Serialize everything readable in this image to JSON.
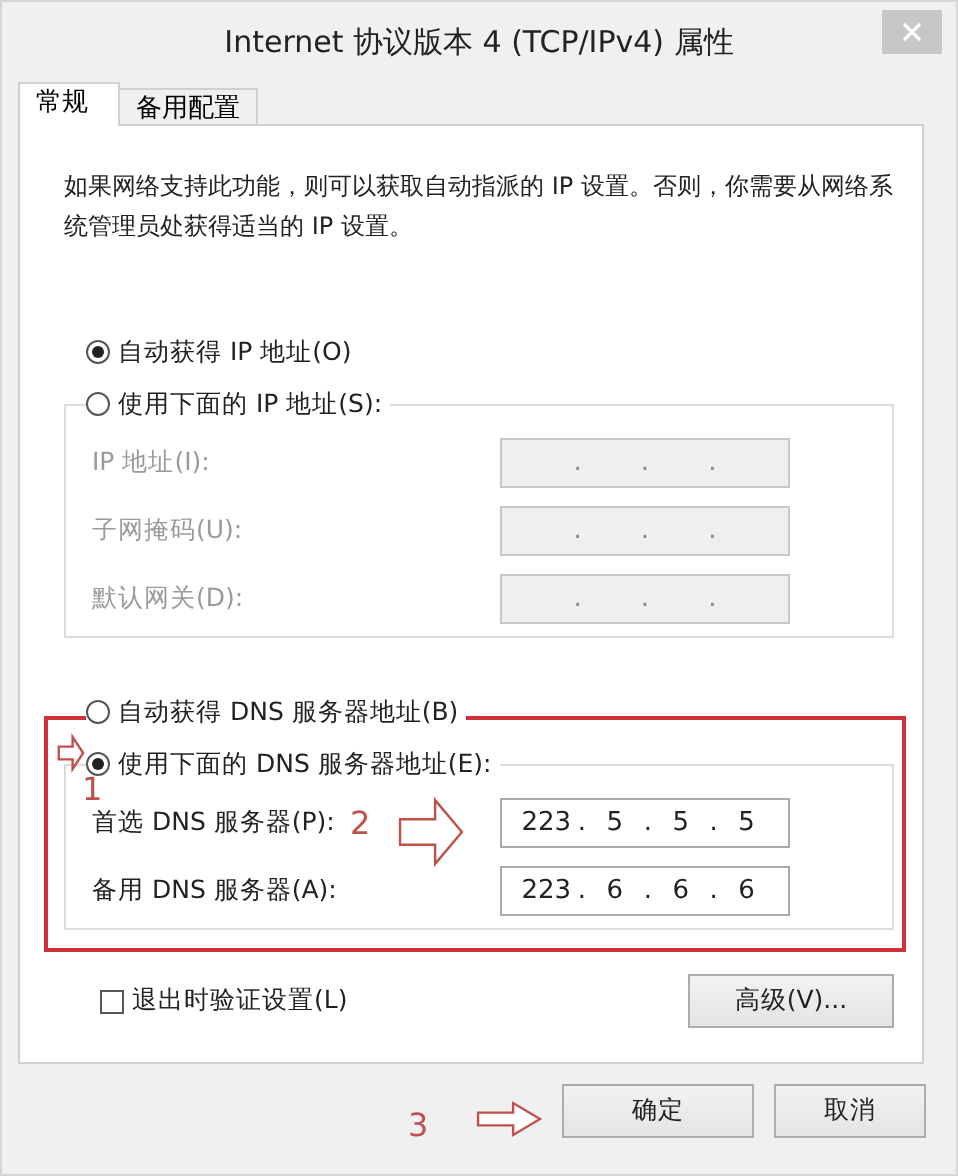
{
  "window": {
    "title": "Internet 协议版本 4 (TCP/IPv4) 属性"
  },
  "tabs": [
    {
      "label": "常规",
      "selected": true
    },
    {
      "label": "备用配置",
      "selected": false
    }
  ],
  "description": "如果网络支持此功能，则可以获取自动指派的 IP 设置。否则，你需要从网络系统管理员处获得适当的 IP 设置。",
  "ip_options": [
    {
      "label": "自动获得 IP 地址(O)",
      "selected": true
    },
    {
      "label": "使用下面的 IP 地址(S):",
      "selected": false
    }
  ],
  "ip_fields": [
    {
      "label": "IP 地址(I):",
      "disabled": true,
      "separator": "."
    },
    {
      "label": "子网掩码(U):",
      "disabled": true,
      "separator": "."
    },
    {
      "label": "默认网关(D):",
      "disabled": true,
      "separator": "."
    }
  ],
  "dns_options": [
    {
      "label": "自动获得 DNS 服务器地址(B)",
      "selected": false
    },
    {
      "label": "使用下面的 DNS 服务器地址(E):",
      "selected": true
    }
  ],
  "dns_fields": [
    {
      "label": "首选 DNS 服务器(P):",
      "disabled": false,
      "separator": ".",
      "octets": [
        "223",
        "5",
        "5",
        "5"
      ]
    },
    {
      "label": "备用 DNS 服务器(A):",
      "disabled": false,
      "separator": ".",
      "octets": [
        "223",
        "6",
        "6",
        "6"
      ]
    }
  ],
  "validate_on_exit": {
    "label": "退出时验证设置(L)",
    "checked": false
  },
  "advanced_button": "高级(V)...",
  "buttons": [
    "确定",
    "取消"
  ],
  "annotations": {
    "labels": [
      "1",
      "2",
      "3"
    ]
  }
}
